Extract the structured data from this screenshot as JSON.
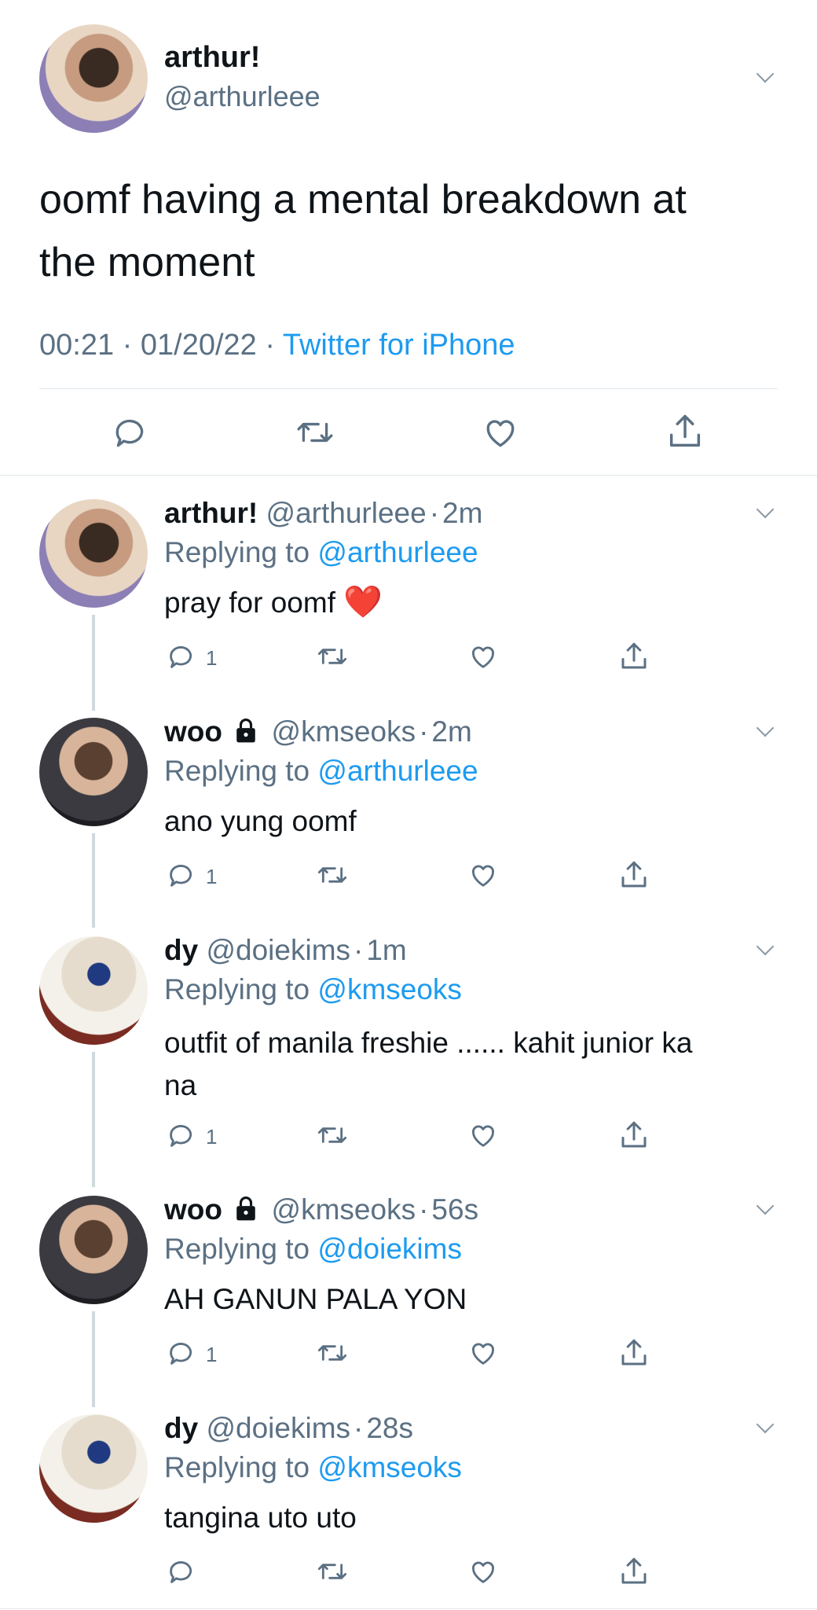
{
  "main_tweet": {
    "name": "arthur!",
    "handle": "@arthurleee",
    "text_line1": "oomf having a mental breakdown at",
    "text_line2": "the moment",
    "time": "00:21 · 01/20/22 ·",
    "source": "Twitter for iPhone"
  },
  "replies": [
    {
      "name": "arthur!",
      "handle": "@arthurleee",
      "dot": "·",
      "time": "2m",
      "replying_prefix": "Replying to",
      "replying_to": "@arthurleee",
      "text": "pray for oomf",
      "emoji": "❤️",
      "reply_count": "1"
    },
    {
      "name": "woo",
      "handle": "@kmseoks",
      "dot": "·",
      "time": "2m",
      "replying_prefix": "Replying to",
      "replying_to": "@arthurleee",
      "text": "ano yung oomf",
      "reply_count": "1"
    },
    {
      "name": "dy",
      "handle": "@doiekims",
      "dot": "·",
      "time": "1m",
      "replying_prefix": "Replying to",
      "replying_to": "@kmseoks",
      "text_line1": "outfit of manila freshie ...... kahit junior ka",
      "text_line2": "na",
      "reply_count": "1"
    },
    {
      "name": "woo",
      "handle": "@kmseoks",
      "dot": "·",
      "time": "56s",
      "replying_prefix": "Replying to",
      "replying_to": "@doiekims",
      "text": "AH GANUN PALA YON",
      "reply_count": "1"
    },
    {
      "name": "dy",
      "handle": "@doiekims",
      "dot": "·",
      "time": "28s",
      "replying_prefix": "Replying to",
      "replying_to": "@kmseoks",
      "text": "tangina uto uto"
    }
  ],
  "icons": {
    "reply": "reply-icon",
    "retweet": "retweet-icon",
    "like": "like-icon",
    "share": "share-icon",
    "chevron": "chevron-down-icon",
    "lock": "lock-icon"
  },
  "colors": {
    "link": "#1d9bf0",
    "muted": "#5b7083",
    "text": "#0f1419",
    "thread_line": "#cfd9de"
  }
}
